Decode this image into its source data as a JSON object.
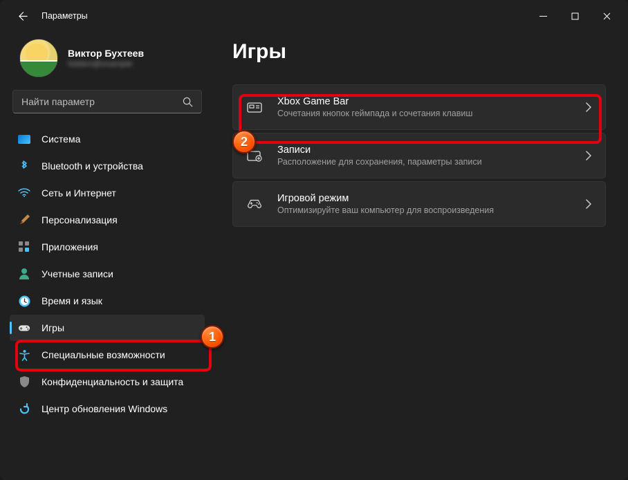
{
  "window": {
    "title": "Параметры"
  },
  "profile": {
    "name": "Виктор Бухтеев",
    "email": "hidden@example"
  },
  "search": {
    "placeholder": "Найти параметр"
  },
  "sidebar": {
    "items": [
      {
        "label": "Система"
      },
      {
        "label": "Bluetooth и устройства"
      },
      {
        "label": "Сеть и Интернет"
      },
      {
        "label": "Персонализация"
      },
      {
        "label": "Приложения"
      },
      {
        "label": "Учетные записи"
      },
      {
        "label": "Время и язык"
      },
      {
        "label": "Игры"
      },
      {
        "label": "Специальные возможности"
      },
      {
        "label": "Конфиденциальность и защита"
      },
      {
        "label": "Центр обновления Windows"
      }
    ]
  },
  "main": {
    "title": "Игры",
    "cards": [
      {
        "title": "Xbox Game Bar",
        "sub": "Сочетания кнопок геймпада и сочетания клавиш"
      },
      {
        "title": "Записи",
        "sub": "Расположение для сохранения, параметры записи"
      },
      {
        "title": "Игровой режим",
        "sub": "Оптимизируйте ваш компьютер для воспроизведения"
      }
    ]
  },
  "annotations": {
    "badge1": "1",
    "badge2": "2"
  }
}
